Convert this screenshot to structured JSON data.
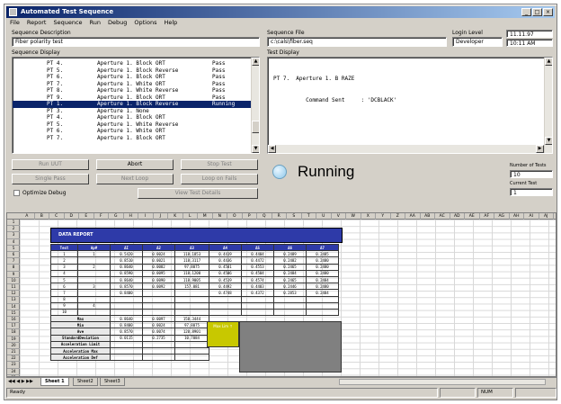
{
  "window": {
    "title": "Automated Test Sequence",
    "controls": [
      "_",
      "□",
      "×"
    ]
  },
  "menu": [
    "File",
    "Report",
    "Sequence",
    "Run",
    "Debug",
    "Options",
    "Help"
  ],
  "labels": {
    "seq_desc": "Sequence Description",
    "seq_file": "Sequence File",
    "login_level": "Login Level",
    "seq_display": "Sequence Display",
    "test_display": "Test Display",
    "num_tests": "Number of Tests",
    "current_test": "Current Test"
  },
  "fields": {
    "seq_desc": "Fiber polarity test",
    "seq_file": "c:\\cals\\fiber.seq",
    "login_level": "Developer",
    "date": "11.11.97",
    "time": "10:11 AM",
    "num_tests": "10",
    "current_test": "1"
  },
  "sequence_rows": [
    {
      "pt": "PT 4.",
      "desc": "Aperture 1. Block ORT",
      "status": "Pass"
    },
    {
      "pt": "PT 5.",
      "desc": "Aperture 1. Block Reverse",
      "status": "Pass"
    },
    {
      "pt": "PT 6.",
      "desc": "Aperture 1. Block ORT",
      "status": "Pass"
    },
    {
      "pt": "PT 7.",
      "desc": "Aperture 1. White ORT",
      "status": "Pass"
    },
    {
      "pt": "PT 8.",
      "desc": "Aperture 1. White Reverse",
      "status": "Pass"
    },
    {
      "pt": "PT 9.",
      "desc": "Aperture 1. Block ORT",
      "status": "Pass"
    },
    {
      "pt": "PT 1.",
      "desc": "Aperture 1. Block Reverse",
      "status": "Running"
    },
    {
      "pt": "PT 3.",
      "desc": "Aperture 1. None",
      "status": ""
    },
    {
      "pt": "PT 4.",
      "desc": "Aperture 1. Block ORT",
      "status": ""
    },
    {
      "pt": "PT 5.",
      "desc": "Aperture 1. White Reverse",
      "status": ""
    },
    {
      "pt": "PT 6.",
      "desc": "Aperture 1. White ORT",
      "status": ""
    },
    {
      "pt": "PT 7.",
      "desc": "Aperture 1. Block ORT",
      "status": ""
    }
  ],
  "test_display": {
    "line1": "PT 7.  Aperture 1. B RAZE",
    "line2": "          Command Sent     : 'DCBLACK'"
  },
  "buttons": {
    "run_test": "Run UUT",
    "abort": "Abort",
    "stop_test": "Stop Test",
    "single_pass": "Single Pass",
    "next_loop": "Next Loop",
    "loop_on_fails": "Loop on Fails",
    "view_test_details": "View Test Details",
    "optimize_debug": "Optimize Debug"
  },
  "status": {
    "text": "Running"
  },
  "sheet": {
    "columns": [
      "A",
      "B",
      "C",
      "D",
      "E",
      "F",
      "G",
      "H",
      "I",
      "J",
      "K",
      "L",
      "M",
      "N",
      "O",
      "P",
      "Q",
      "R",
      "S",
      "T",
      "U",
      "V",
      "W",
      "X",
      "Y",
      "Z",
      "AA",
      "AB",
      "AC",
      "AD",
      "AE",
      "AF",
      "AG",
      "AH",
      "AI",
      "AJ"
    ],
    "rows": [
      "1",
      "2",
      "3",
      "4",
      "5",
      "6",
      "7",
      "8",
      "9",
      "10",
      "11",
      "12",
      "13",
      "14",
      "15",
      "16",
      "17",
      "18",
      "19",
      "20",
      "21",
      "22",
      "23",
      "24",
      "25"
    ],
    "report_title": "DATA REPORT",
    "report_headers": [
      "Test",
      "Ap#",
      "ΔI",
      "Δ2",
      "Δ3",
      "Δ4",
      "Δ5",
      "Δ6",
      "Δ7",
      "Δ8"
    ],
    "report_rows": [
      [
        "1",
        "1",
        "0.5420",
        "0.0024",
        "118.1853",
        "0.4419",
        "0.4404",
        "0.2489",
        "0.2485"
      ],
      [
        "2",
        "",
        "0.8510",
        "0.0021",
        "118.3117",
        "0.4436",
        "0.4472",
        "0.2482",
        "0.2480"
      ],
      [
        "3",
        "2",
        "0.8640",
        "0.0082",
        "97.8075",
        "0.4501",
        "0.4553",
        "0.2465",
        "0.2480"
      ],
      [
        "4",
        "",
        "0.8590",
        "0.0095",
        "118.1200",
        "0.4506",
        "0.4504",
        "0.2484",
        "0.2480"
      ],
      [
        "5",
        "",
        "0.8640",
        "0.0090",
        "118.9005",
        "0.4519",
        "0.4574",
        "0.2465",
        "0.2484"
      ],
      [
        "6",
        "3",
        "0.8570",
        "0.0092",
        "157.081",
        "0.4492",
        "0.4403",
        "0.2446",
        "0.2480"
      ],
      [
        "7",
        "",
        "0.8400",
        "",
        "",
        "0.4748",
        "0.4372",
        "0.2853",
        "0.2484"
      ],
      [
        "8",
        "",
        "",
        "",
        "",
        "",
        "",
        "",
        ""
      ],
      [
        "9",
        "4",
        "",
        "",
        "",
        "",
        "",
        "",
        ""
      ],
      [
        "10",
        "",
        "",
        "",
        "",
        "",
        "",
        "",
        ""
      ]
    ],
    "stats": [
      {
        "label": "Max",
        "vals": [
          "0.8640",
          "0.0097",
          "158.3444"
        ]
      },
      {
        "label": "Min",
        "vals": [
          "0.8400",
          "0.0024",
          "97.8075"
        ]
      },
      {
        "label": "Ave",
        "vals": [
          "0.8570",
          "0.0074",
          "120.8901"
        ]
      },
      {
        "label": "StandardDeviation",
        "vals": [
          "0.0115",
          "0.2735",
          "10.7084"
        ]
      },
      {
        "label": "Acceleration Limit",
        "vals": [
          "",
          "",
          ""
        ]
      },
      {
        "label": "Acceleration Max",
        "vals": [
          "",
          "",
          ""
        ]
      },
      {
        "label": "Acceleration Def",
        "vals": [
          "",
          "",
          ""
        ]
      }
    ],
    "yellow_cell": "Max Lim ↑",
    "tabs": [
      "Sheet 1",
      "Sheet2",
      "Sheet3"
    ]
  },
  "statusbar": {
    "left": "Ready",
    "right": "NUM"
  }
}
